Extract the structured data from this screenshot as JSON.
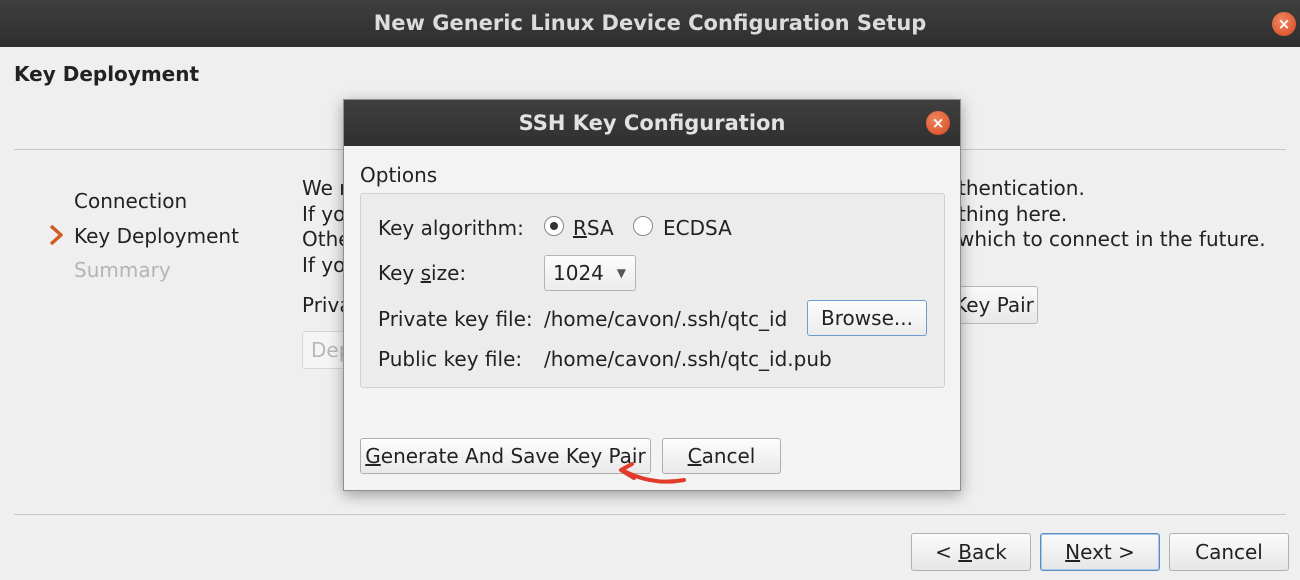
{
  "window": {
    "title": "New Generic Linux Device Configuration Setup",
    "close_glyph": "×"
  },
  "page": {
    "title": "Key Deployment",
    "steps": [
      {
        "label": "Connection",
        "state": "done"
      },
      {
        "label": "Key Deployment",
        "state": "current"
      },
      {
        "label": "Summary",
        "state": "pending"
      }
    ],
    "background_text": {
      "line1_start": "We r",
      "line1_end": "thentication.",
      "line2_start": "If yo",
      "line2_end": "thing here.",
      "line3_start": "Othe",
      "line3_end": "which to connect in the future.",
      "line4_start": "If yo",
      "private_key_label": "Priva",
      "key_pair_button_fragment": "Key Pair",
      "deploy_fragment": "Dep"
    },
    "nav": {
      "back": "< Back",
      "next": "Next >",
      "cancel": "Cancel"
    }
  },
  "dialog": {
    "title": "SSH Key Configuration",
    "close_glyph": "×",
    "group_label": "Options",
    "key_algorithm_label": "Key algorithm:",
    "algorithms": [
      {
        "label": "RSA",
        "selected": true
      },
      {
        "label": "ECDSA",
        "selected": false
      }
    ],
    "key_size_label": "Key size:",
    "key_size_value": "1024",
    "private_key_label": "Private key file:",
    "private_key_path": "/home/cavon/.ssh/qtc_id",
    "browse_label": "Browse...",
    "public_key_label": "Public key file:",
    "public_key_path": "/home/cavon/.ssh/qtc_id.pub",
    "generate_label": "Generate And Save Key Pair",
    "cancel_label": "Cancel"
  },
  "colors": {
    "annotation_arrow": "#e23b2a",
    "titlebar": "#353535",
    "close_button": "#e0562b"
  }
}
